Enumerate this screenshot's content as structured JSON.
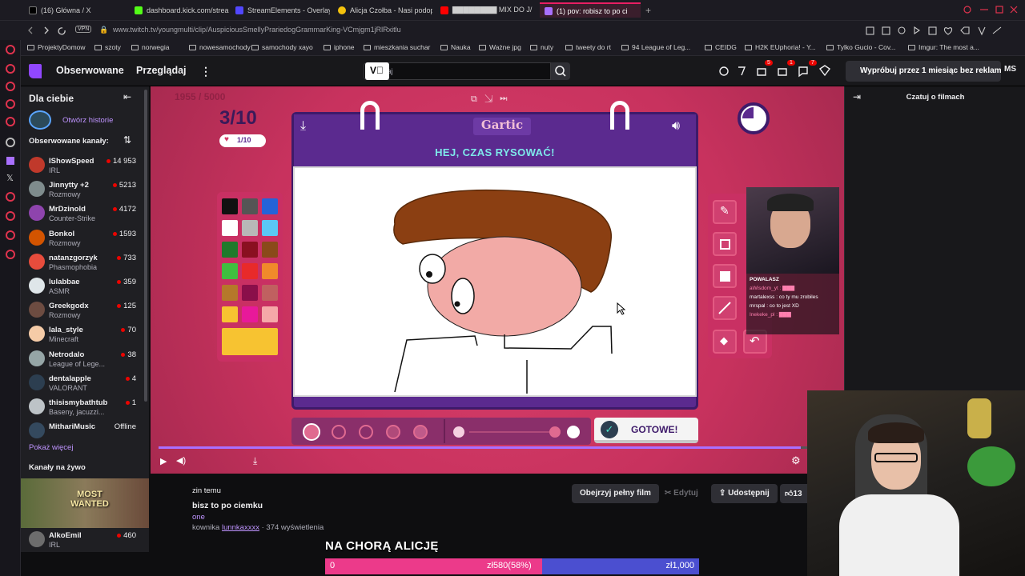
{
  "browser": {
    "tabs": [
      {
        "title": "(16) Główna / X",
        "fav_color": "#000000"
      },
      {
        "title": "dashboard.kick.com/strea",
        "fav_color": "#53fc18"
      },
      {
        "title": "StreamElements - Overlay",
        "fav_color": "#5247ff"
      },
      {
        "title": "Alicja Czołba - Nasi podop",
        "fav_color": "#f4c20d"
      },
      {
        "title": "▇▇▇▇▇▇▇▇ MIX DO J/",
        "fav_color": "#ff0000"
      },
      {
        "title": "(1) pov: robisz to po ci",
        "fav_color": "#a970ff"
      }
    ],
    "new_tab": "+",
    "vpn": "VPN",
    "url": "www.twitch.tv/youngmulti/clip/AuspiciousSmellyPrariedogGrammarKing-VCmjgm1jRlRxitlu",
    "bookmarks": [
      "ProjektyDomow",
      "szoty",
      "norwegia",
      "nowesamochody",
      "samochody xayo",
      "iphone",
      "mieszkania suchar",
      "Nauka",
      "Ważne jpg",
      "nuty",
      "tweety do rt",
      "94 League of Leg...",
      "CEIDG",
      "H2K EUphoria! - Y...",
      "Tylko Gucio - Cov...",
      "Imgur: The most a..."
    ]
  },
  "twitch_nav": {
    "following": "Obserwowane",
    "browse": "Przeglądaj",
    "search_placeholder": "kaj",
    "notif_counts": [
      "5",
      "1",
      "7"
    ],
    "ad_free": "Wypróbuj przez 1 miesiąc bez reklam",
    "user_initials": "MS"
  },
  "sidebar": {
    "for_you": "Dla ciebie",
    "stories": "Otwórz historie",
    "followed_header": "Obserwowane kanały:",
    "channels": [
      {
        "name": "IShowSpeed",
        "game": "IRL",
        "viewers": "14 953",
        "color": "#c0392b"
      },
      {
        "name": "Jinnytty +2",
        "game": "Rozmowy",
        "viewers": "5213",
        "color": "#7f8c8d"
      },
      {
        "name": "MrDzinold",
        "game": "Counter-Strike",
        "viewers": "4172",
        "color": "#8e44ad"
      },
      {
        "name": "Bonkol",
        "game": "Rozmowy",
        "viewers": "1593",
        "color": "#d35400"
      },
      {
        "name": "natanzgorzyk",
        "game": "Phasmophobia",
        "viewers": "733",
        "color": "#e74c3c"
      },
      {
        "name": "lulabbae",
        "game": "ASMR",
        "viewers": "359",
        "color": "#dfe6e9"
      },
      {
        "name": "Greekgodx",
        "game": "Rozmowy",
        "viewers": "125",
        "color": "#6d4c41"
      },
      {
        "name": "lala_style",
        "game": "Minecraft",
        "viewers": "70",
        "color": "#f5cba7"
      },
      {
        "name": "Netrodalo",
        "game": "League of Lege...",
        "viewers": "38",
        "color": "#95a5a6"
      },
      {
        "name": "dentalapple",
        "game": "VALORANT",
        "viewers": "4",
        "color": "#2c3e50"
      },
      {
        "name": "thisismybathtub",
        "game": "Baseny, jacuzzi...",
        "viewers": "1",
        "color": "#bdc3c7"
      },
      {
        "name": "MithariMusic",
        "game": "",
        "viewers": "Offline",
        "color": "#34495e"
      }
    ],
    "show_more": "Pokaż więcej",
    "live_channels": "Kanały na żywo",
    "bottom_channel": {
      "name": "AlkoEmil",
      "game": "IRL",
      "viewers": "460"
    },
    "ad_text": "MOST WANTED"
  },
  "game": {
    "round": "3/10",
    "heart": "1/10",
    "logo": "Gartic",
    "header": "HEJ, CZAS RYSOWAĆ!",
    "done": "GOTOWE!",
    "palette": [
      "#111111",
      "#555555",
      "#2563d8",
      "#ffffff",
      "#b8b8b8",
      "#5ac8f5",
      "#1f7a2b",
      "#8a1020",
      "#8a4a1a",
      "#3fbf3f",
      "#e82a2a",
      "#f08a2a",
      "#b5782a",
      "#8a0f4a",
      "#c06060",
      "#f7c331",
      "#e8199a",
      "#f5a8a8"
    ],
    "selected_color": "#f7c331",
    "overlay_title": "1955 / 5000",
    "chat_lines": [
      "POWALASZ",
      "aWisdom_yt : ▇▇▇",
      "martalexss : co ty mu zrobiles",
      "mrspal : co to jest XD",
      "Inekeke_pl : ▇▇▇"
    ]
  },
  "chat": {
    "title": "Czatuj o filmach"
  },
  "clip": {
    "time_ago": "zin temu",
    "title": "bisz to po ciemku",
    "category": "one",
    "by_prefix": "kownika",
    "clipper": "lunnkaxxxx",
    "views": "· 374 wyświetlenia",
    "watch_full": "Obejrzyj pełny film",
    "edit": "Edytuj",
    "share": "Udostępnij",
    "likes": "13",
    "progress": 0.99
  },
  "poll": {
    "question": "NA CHORĄ ALICJĘ",
    "left_value": "0",
    "middle_label": "zł580(58%)",
    "right_value": "zł1,000",
    "fraction": 0.58
  }
}
